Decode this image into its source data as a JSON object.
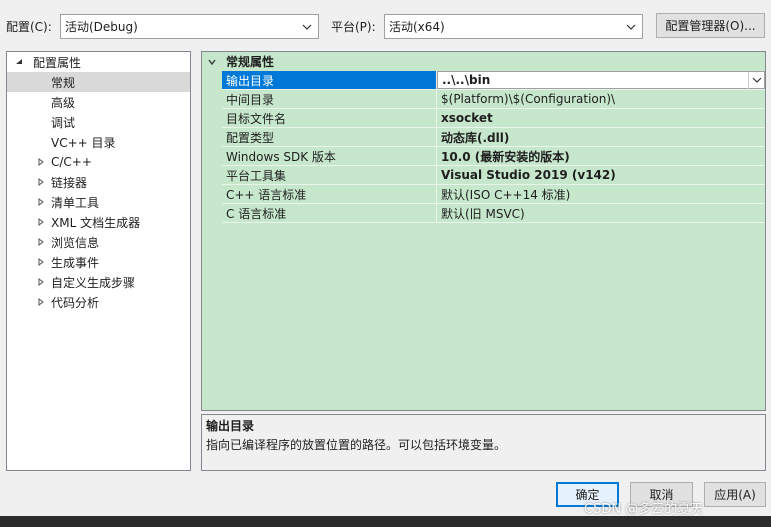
{
  "topbar": {
    "config_label": "配置(C):",
    "config_value": "活动(Debug)",
    "platform_label": "平台(P):",
    "platform_value": "活动(x64)",
    "config_manager_button": "配置管理器(O)..."
  },
  "tree": {
    "root": "配置属性",
    "items": [
      {
        "label": "常规",
        "selected": true,
        "expandable": false
      },
      {
        "label": "高级",
        "expandable": false
      },
      {
        "label": "调试",
        "expandable": false
      },
      {
        "label": "VC++ 目录",
        "expandable": false
      },
      {
        "label": "C/C++",
        "expandable": true
      },
      {
        "label": "链接器",
        "expandable": true
      },
      {
        "label": "清单工具",
        "expandable": true
      },
      {
        "label": "XML 文档生成器",
        "expandable": true
      },
      {
        "label": "浏览信息",
        "expandable": true
      },
      {
        "label": "生成事件",
        "expandable": true
      },
      {
        "label": "自定义生成步骤",
        "expandable": true
      },
      {
        "label": "代码分析",
        "expandable": true
      }
    ]
  },
  "grid": {
    "section": "常规属性",
    "rows": [
      {
        "name": "输出目录",
        "value": "..\\..\\bin",
        "bold": true,
        "selected": true
      },
      {
        "name": "中间目录",
        "value": "$(Platform)\\$(Configuration)\\",
        "bold": false
      },
      {
        "name": "目标文件名",
        "value": "xsocket",
        "bold": true
      },
      {
        "name": "配置类型",
        "value": "动态库(.dll)",
        "bold": true
      },
      {
        "name": "Windows SDK 版本",
        "value": "10.0 (最新安装的版本)",
        "bold": true
      },
      {
        "name": "平台工具集",
        "value": "Visual Studio 2019 (v142)",
        "bold": true
      },
      {
        "name": "C++ 语言标准",
        "value": "默认(ISO C++14 标准)",
        "bold": false
      },
      {
        "name": "C 语言标准",
        "value": "默认(旧 MSVC)",
        "bold": false
      }
    ]
  },
  "description": {
    "title": "输出目录",
    "text": "指向已编译程序的放置位置的路径。可以包括环境变量。"
  },
  "buttons": {
    "ok": "确定",
    "cancel": "取消",
    "apply": "应用(A)"
  },
  "watermark": "CSDN @多云的夏天",
  "colors": {
    "grid_bg": "#c7e7cd",
    "selection_blue": "#0078d7",
    "dialog_bg": "#f0f0f0"
  }
}
